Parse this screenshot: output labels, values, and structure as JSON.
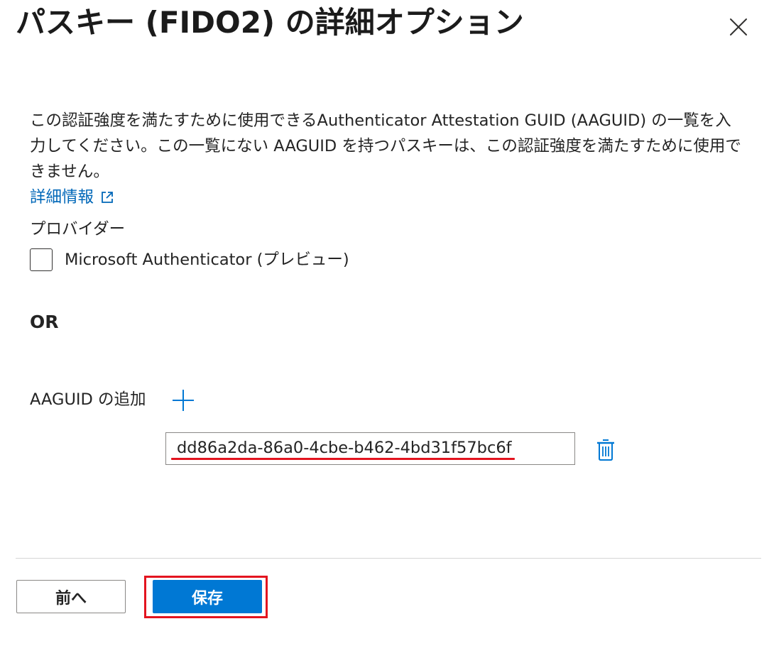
{
  "panel": {
    "title": "パスキー (FIDO2) の詳細オプション"
  },
  "description": "この認証強度を満たすために使用できるAuthenticator Attestation GUID (AAGUID) の一覧を入力してください。この一覧にない AAGUID を持つパスキーは、この認証強度を満たすために使用できません。",
  "learn_more": {
    "label": "詳細情報"
  },
  "providers": {
    "label": "プロバイダー",
    "options": [
      {
        "label": "Microsoft Authenticator (プレビュー)",
        "checked": false
      }
    ]
  },
  "or_label": "OR",
  "aaguid": {
    "label": "AAGUID の追加",
    "entries": [
      {
        "value": "dd86a2da-86a0-4cbe-b462-4bd31f57bc6f"
      }
    ]
  },
  "footer": {
    "back_label": "前へ",
    "save_label": "保存"
  },
  "colors": {
    "accent": "#0078d4",
    "link": "#0067b8",
    "highlight": "#e3141f"
  },
  "icons": {
    "close": "close-icon",
    "external_link": "external-link-icon",
    "add": "plus-icon",
    "delete": "trash-icon"
  }
}
